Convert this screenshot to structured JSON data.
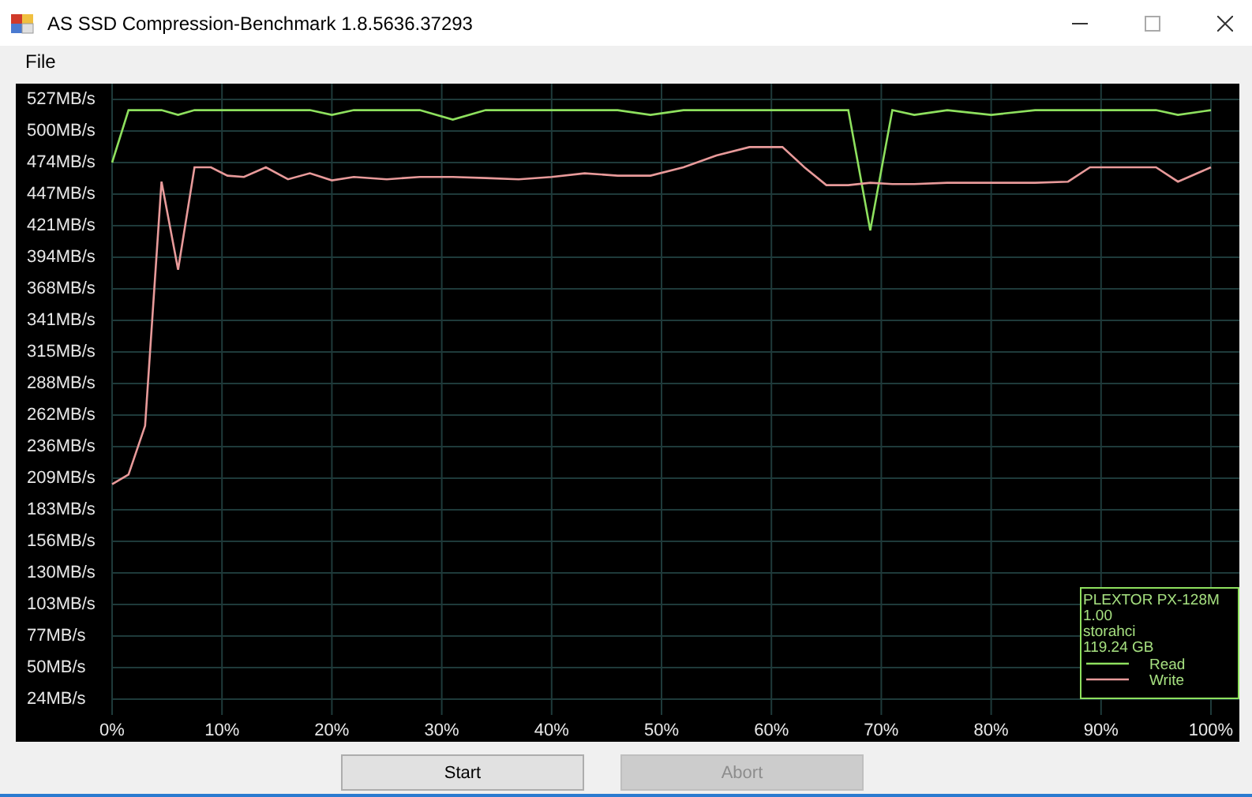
{
  "window": {
    "title": "AS SSD Compression-Benchmark 1.8.5636.37293"
  },
  "menu": [
    {
      "label": "File"
    }
  ],
  "chart": {
    "chart_data": {
      "type": "line",
      "x": [
        0,
        1.5,
        3,
        4.5,
        6,
        7.5,
        9,
        10.5,
        12,
        14,
        16,
        18,
        20,
        22,
        25,
        28,
        31,
        34,
        37,
        40,
        43,
        46,
        49,
        52,
        55,
        58,
        61,
        63,
        65,
        67,
        69,
        71,
        73,
        76,
        80,
        84,
        87,
        89,
        92,
        95,
        97,
        100
      ],
      "series": [
        {
          "name": "Read",
          "color": "#8ee05e",
          "values": [
            474,
            518,
            518,
            518,
            514,
            518,
            518,
            518,
            518,
            518,
            518,
            518,
            514,
            518,
            518,
            518,
            510,
            518,
            518,
            518,
            518,
            518,
            514,
            518,
            518,
            518,
            518,
            518,
            518,
            518,
            417,
            518,
            514,
            518,
            514,
            518,
            518,
            518,
            518,
            518,
            514,
            518
          ]
        },
        {
          "name": "Write",
          "color": "#e89a9a",
          "values": [
            204,
            212,
            253,
            458,
            384,
            470,
            470,
            463,
            462,
            470,
            460,
            465,
            459,
            462,
            460,
            462,
            462,
            461,
            460,
            462,
            465,
            463,
            463,
            470,
            480,
            487,
            487,
            470,
            455,
            455,
            457,
            456,
            456,
            457,
            457,
            457,
            458,
            470,
            470,
            470,
            458,
            470
          ]
        }
      ],
      "grid": true,
      "legend": "lower right",
      "xlim": [
        0,
        100
      ],
      "ylim": [
        10.25,
        540.25
      ],
      "yticks": [
        {
          "value": 527,
          "label": "527MB/s"
        },
        {
          "value": 500.5,
          "label": "500MB/s"
        },
        {
          "value": 474,
          "label": "474MB/s"
        },
        {
          "value": 447.5,
          "label": "447MB/s"
        },
        {
          "value": 421,
          "label": "421MB/s"
        },
        {
          "value": 394.5,
          "label": "394MB/s"
        },
        {
          "value": 368,
          "label": "368MB/s"
        },
        {
          "value": 341.5,
          "label": "341MB/s"
        },
        {
          "value": 315,
          "label": "315MB/s"
        },
        {
          "value": 288.5,
          "label": "288MB/s"
        },
        {
          "value": 262,
          "label": "262MB/s"
        },
        {
          "value": 235.5,
          "label": "236MB/s"
        },
        {
          "value": 209,
          "label": "209MB/s"
        },
        {
          "value": 182.5,
          "label": "183MB/s"
        },
        {
          "value": 156,
          "label": "156MB/s"
        },
        {
          "value": 129.5,
          "label": "130MB/s"
        },
        {
          "value": 103,
          "label": "103MB/s"
        },
        {
          "value": 76.5,
          "label": "77MB/s"
        },
        {
          "value": 50,
          "label": "50MB/s"
        },
        {
          "value": 23.5,
          "label": "24MB/s"
        }
      ],
      "xticks": [
        {
          "value": 0,
          "label": "0%"
        },
        {
          "value": 10,
          "label": "10%"
        },
        {
          "value": 20,
          "label": "20%"
        },
        {
          "value": 30,
          "label": "30%"
        },
        {
          "value": 40,
          "label": "40%"
        },
        {
          "value": 50,
          "label": "50%"
        },
        {
          "value": 60,
          "label": "60%"
        },
        {
          "value": 70,
          "label": "70%"
        },
        {
          "value": 80,
          "label": "80%"
        },
        {
          "value": 90,
          "label": "90%"
        },
        {
          "value": 100,
          "label": "100%"
        }
      ]
    },
    "info": [
      "PLEXTOR PX-128M",
      "1.00",
      "storahci",
      "119.24 GB"
    ]
  },
  "buttons": [
    {
      "label": "Start",
      "disabled": false
    },
    {
      "label": "Abort",
      "disabled": true
    }
  ]
}
